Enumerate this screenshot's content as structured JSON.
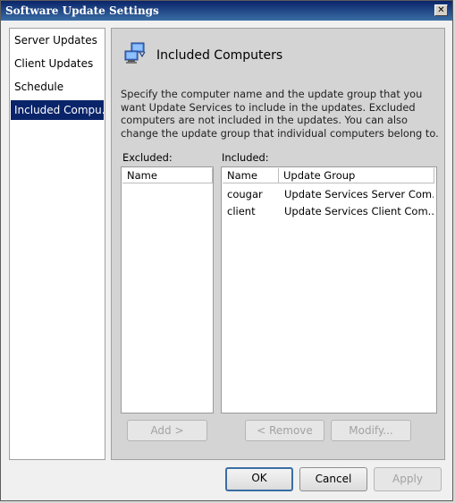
{
  "window": {
    "title": "Software Update Settings",
    "close_glyph": "✕"
  },
  "nav": {
    "items": [
      {
        "label": "Server Updates"
      },
      {
        "label": "Client Updates"
      },
      {
        "label": "Schedule"
      },
      {
        "label": "Included Compu..."
      }
    ],
    "selected": "Included Compu..."
  },
  "page": {
    "icon": "computers-icon",
    "title": "Included Computers",
    "description": "Specify the computer name and the update group that you want Update Services to include in the updates. Excluded computers are not included in the updates. You can also change the update group that individual computers belong to."
  },
  "excluded": {
    "label": "Excluded:",
    "columns": [
      "Name"
    ],
    "rows": []
  },
  "included": {
    "label": "Included:",
    "columns": [
      "Name",
      "Update Group"
    ],
    "rows": [
      {
        "name": "cougar",
        "group": "Update Services Server Com..."
      },
      {
        "name": "client",
        "group": "Update Services Client Com..."
      }
    ]
  },
  "buttons": {
    "add": "Add >",
    "remove": "< Remove",
    "modify": "Modify...",
    "ok": "OK",
    "cancel": "Cancel",
    "apply": "Apply"
  }
}
